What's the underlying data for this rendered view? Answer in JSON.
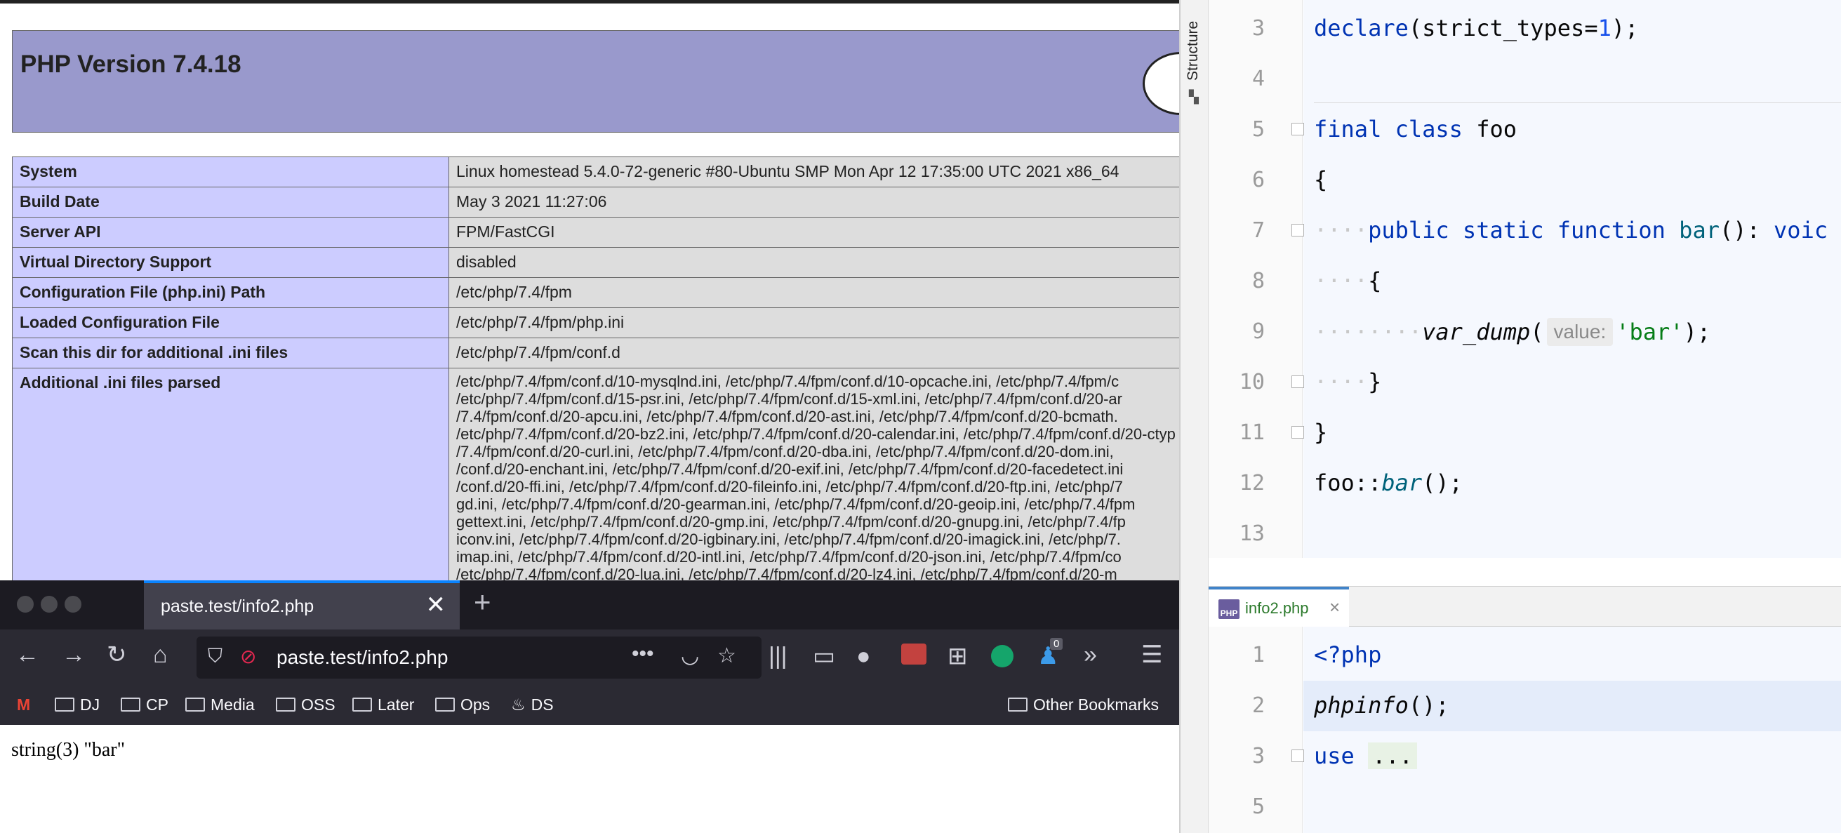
{
  "phpinfo": {
    "title": "PHP Version 7.4.18",
    "rows": [
      {
        "key": "System",
        "value": "Linux homestead 5.4.0-72-generic #80-Ubuntu SMP Mon Apr 12 17:35:00 UTC 2021 x86_64"
      },
      {
        "key": "Build Date",
        "value": "May 3 2021 11:27:06"
      },
      {
        "key": "Server API",
        "value": "FPM/FastCGI"
      },
      {
        "key": "Virtual Directory Support",
        "value": "disabled"
      },
      {
        "key": "Configuration File (php.ini) Path",
        "value": "/etc/php/7.4/fpm"
      },
      {
        "key": "Loaded Configuration File",
        "value": "/etc/php/7.4/fpm/php.ini"
      },
      {
        "key": "Scan this dir for additional .ini files",
        "value": "/etc/php/7.4/fpm/conf.d"
      }
    ],
    "additional_key": "Additional .ini files parsed",
    "additional_lines": [
      "/etc/php/7.4/fpm/conf.d/10-mysqlnd.ini, /etc/php/7.4/fpm/conf.d/10-opcache.ini, /etc/php/7.4/fpm/c",
      "/etc/php/7.4/fpm/conf.d/15-psr.ini, /etc/php/7.4/fpm/conf.d/15-xml.ini, /etc/php/7.4/fpm/conf.d/20-ar",
      "/7.4/fpm/conf.d/20-apcu.ini, /etc/php/7.4/fpm/conf.d/20-ast.ini, /etc/php/7.4/fpm/conf.d/20-bcmath.",
      "/etc/php/7.4/fpm/conf.d/20-bz2.ini, /etc/php/7.4/fpm/conf.d/20-calendar.ini, /etc/php/7.4/fpm/conf.d/20-ctyp",
      "/7.4/fpm/conf.d/20-curl.ini, /etc/php/7.4/fpm/conf.d/20-dba.ini, /etc/php/7.4/fpm/conf.d/20-dom.ini,",
      "/conf.d/20-enchant.ini, /etc/php/7.4/fpm/conf.d/20-exif.ini, /etc/php/7.4/fpm/conf.d/20-facedetect.ini",
      "/conf.d/20-ffi.ini, /etc/php/7.4/fpm/conf.d/20-fileinfo.ini, /etc/php/7.4/fpm/conf.d/20-ftp.ini, /etc/php/7",
      "gd.ini, /etc/php/7.4/fpm/conf.d/20-gearman.ini, /etc/php/7.4/fpm/conf.d/20-geoip.ini, /etc/php/7.4/fpm",
      "gettext.ini, /etc/php/7.4/fpm/conf.d/20-gmp.ini, /etc/php/7.4/fpm/conf.d/20-gnupg.ini, /etc/php/7.4/fp",
      "iconv.ini, /etc/php/7.4/fpm/conf.d/20-igbinary.ini, /etc/php/7.4/fpm/conf.d/20-imagick.ini, /etc/php/7.",
      "imap.ini, /etc/php/7.4/fpm/conf.d/20-intl.ini, /etc/php/7.4/fpm/conf.d/20-json.ini, /etc/php/7.4/fpm/co",
      "/etc/php/7.4/fpm/conf.d/20-lua.ini, /etc/php/7.4/fpm/conf.d/20-lz4.ini, /etc/php/7.4/fpm/conf.d/20-m"
    ]
  },
  "firefox": {
    "tab_title": "paste.test/info2.php",
    "url": "paste.test/info2.php",
    "bookmarks": [
      "DJ",
      "CP",
      "Media",
      "OSS",
      "Later",
      "Ops",
      "DS"
    ],
    "other_bookmarks": "Other Bookmarks",
    "badge_count": "0",
    "page_output": "string(3) \"bar\""
  },
  "ide": {
    "structure_label": "Structure",
    "top_editor_lines": [
      {
        "n": "3"
      },
      {
        "n": "4"
      },
      {
        "n": "5"
      },
      {
        "n": "6"
      },
      {
        "n": "7"
      },
      {
        "n": "8"
      },
      {
        "n": "9"
      },
      {
        "n": "10"
      },
      {
        "n": "11"
      },
      {
        "n": "12"
      },
      {
        "n": "13"
      }
    ],
    "code": {
      "declare": "declare",
      "strict": "(strict_types=",
      "one": "1",
      "declare_end": ");",
      "final": "final",
      "class": "class",
      "class_name": "foo",
      "brace_open": "{",
      "public": "public",
      "static": "static",
      "function": "function",
      "method": "bar",
      "sig_rest": "(): ",
      "ret_type": "voic",
      "inner_open": "{",
      "var_dump": "var_dump",
      "paren_open": "(",
      "hint": "value:",
      "bar_str": "'bar'",
      "call_end": ");",
      "inner_close": "}",
      "brace_close": "}",
      "static_call_class": "foo::",
      "static_call_method": "bar",
      "static_call_end": "();"
    },
    "tab": {
      "icon": "PHP",
      "label": "info2.php"
    },
    "bottom_editor": {
      "lines": [
        {
          "n": "1"
        },
        {
          "n": "2"
        },
        {
          "n": "3"
        },
        {
          "n": "5"
        }
      ],
      "open_tag": "<?php",
      "phpinfo_call": "phpinfo",
      "phpinfo_end": "();",
      "use_kw": "use",
      "use_folded": "..."
    }
  }
}
